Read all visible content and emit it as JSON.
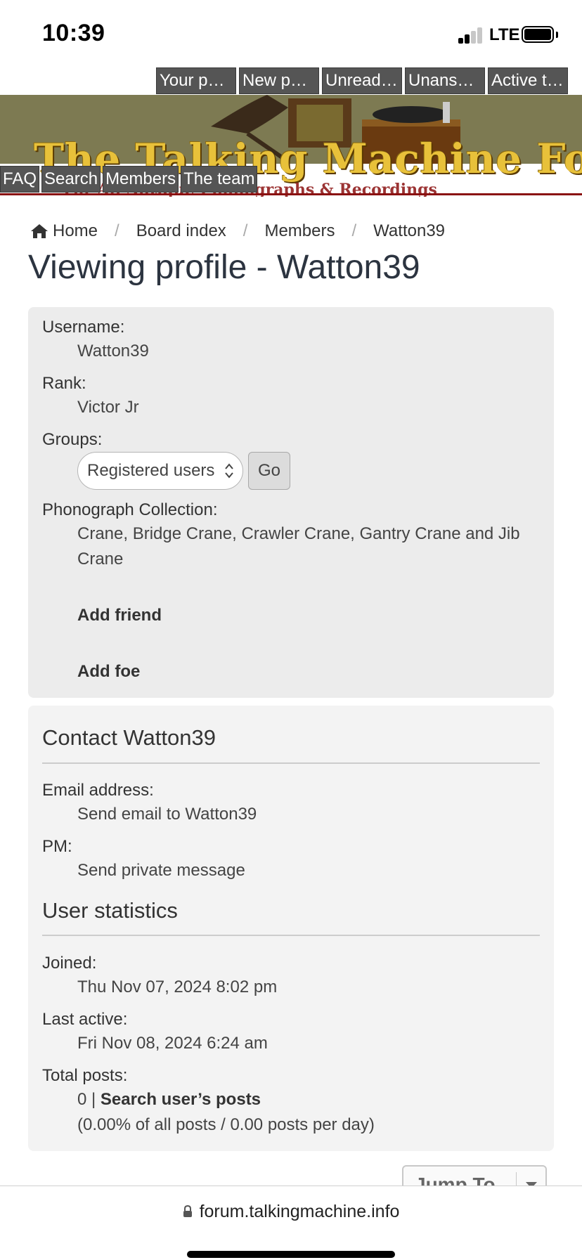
{
  "status_bar": {
    "time": "10:39",
    "network": "LTE"
  },
  "top_nav": [
    "Your po…",
    "New po…",
    "Unread …",
    "Unans…",
    "Active t…"
  ],
  "banner": {
    "title": "The Talking Machine Forum",
    "subtitle": "For All Antique Phonographs & Recordings"
  },
  "sub_nav": [
    "FAQ",
    "Search",
    "Members",
    "The team"
  ],
  "breadcrumb": [
    "Home",
    "Board index",
    "Members",
    "Watton39"
  ],
  "page_title": "Viewing profile - Watton39",
  "profile": {
    "username_label": "Username:",
    "username": "Watton39",
    "rank_label": "Rank:",
    "rank": "Victor Jr",
    "groups_label": "Groups:",
    "groups_selected": "Registered users",
    "go_label": "Go",
    "collection_label": "Phonograph Collection:",
    "collection": "Crane, Bridge Crane, Crawler Crane, Gantry Crane and Jib Crane",
    "add_friend": "Add friend",
    "add_foe": "Add foe"
  },
  "contact": {
    "title": "Contact Watton39",
    "email_label": "Email address:",
    "email_link": "Send email to Watton39",
    "pm_label": "PM:",
    "pm_link": "Send private message"
  },
  "stats": {
    "title": "User statistics",
    "joined_label": "Joined:",
    "joined": "Thu Nov 07, 2024 8:02 pm",
    "last_active_label": "Last active:",
    "last_active": "Fri Nov 08, 2024 6:24 am",
    "total_posts_label": "Total posts:",
    "total_posts": "0 |",
    "search_posts_link": "Search user’s posts",
    "posts_detail": "(0.00% of all posts / 0.00 posts per day)"
  },
  "jump_to": "Jump To",
  "browser": {
    "url": "forum.talkingmachine.info"
  },
  "colors": {
    "nav_bg": "#555555",
    "panel_bg": "#ececec",
    "banner_bg": "#7d7a52",
    "banner_title": "#e8c13a"
  }
}
